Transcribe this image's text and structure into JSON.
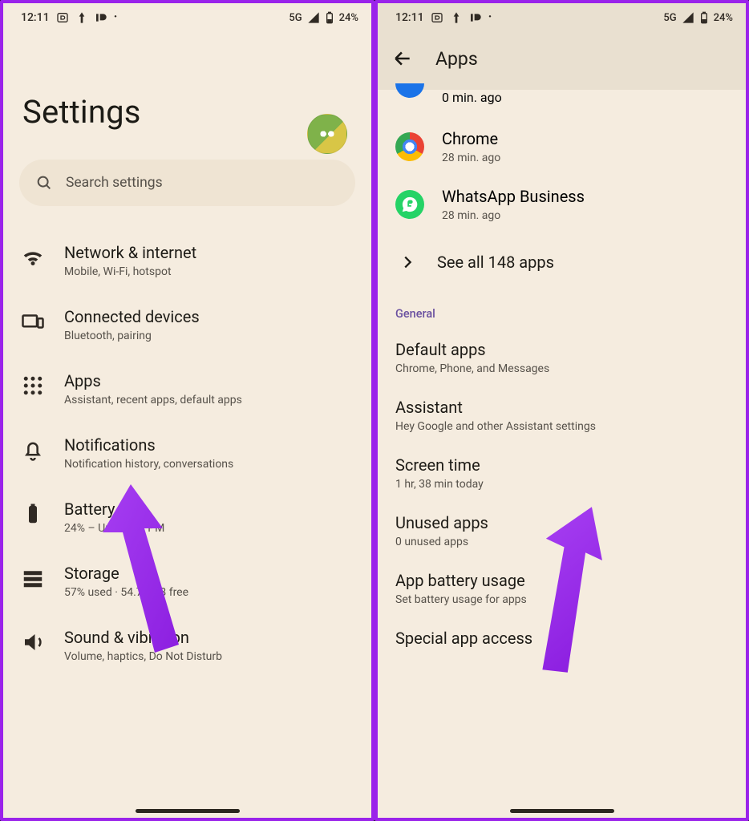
{
  "statusbar": {
    "time": "12:11",
    "signal": "5G",
    "battery": "24%"
  },
  "left": {
    "title": "Settings",
    "search_placeholder": "Search settings",
    "items": [
      {
        "label": "Network & internet",
        "sub": "Mobile, Wi-Fi, hotspot"
      },
      {
        "label": "Connected devices",
        "sub": "Bluetooth, pairing"
      },
      {
        "label": "Apps",
        "sub": "Assistant, recent apps, default apps"
      },
      {
        "label": "Notifications",
        "sub": "Notification history, conversations"
      },
      {
        "label": "Battery",
        "sub": "24% – Until 6:30 PM"
      },
      {
        "label": "Storage",
        "sub": "57% used · 54.72 GB free"
      },
      {
        "label": "Sound & vibration",
        "sub": "Volume, haptics, Do Not Disturb"
      }
    ]
  },
  "right": {
    "title": "Apps",
    "peek_sub": "0 min. ago",
    "apps": [
      {
        "label": "Chrome",
        "sub": "28 min. ago"
      },
      {
        "label": "WhatsApp Business",
        "sub": "28 min. ago"
      }
    ],
    "see_all": "See all 148 apps",
    "section": "General",
    "general": [
      {
        "label": "Default apps",
        "sub": "Chrome, Phone, and Messages"
      },
      {
        "label": "Assistant",
        "sub": "Hey Google and other Assistant settings"
      },
      {
        "label": "Screen time",
        "sub": "1 hr, 38 min today"
      },
      {
        "label": "Unused apps",
        "sub": "0 unused apps"
      },
      {
        "label": "App battery usage",
        "sub": "Set battery usage for apps"
      },
      {
        "label": "Special app access",
        "sub": ""
      }
    ]
  }
}
